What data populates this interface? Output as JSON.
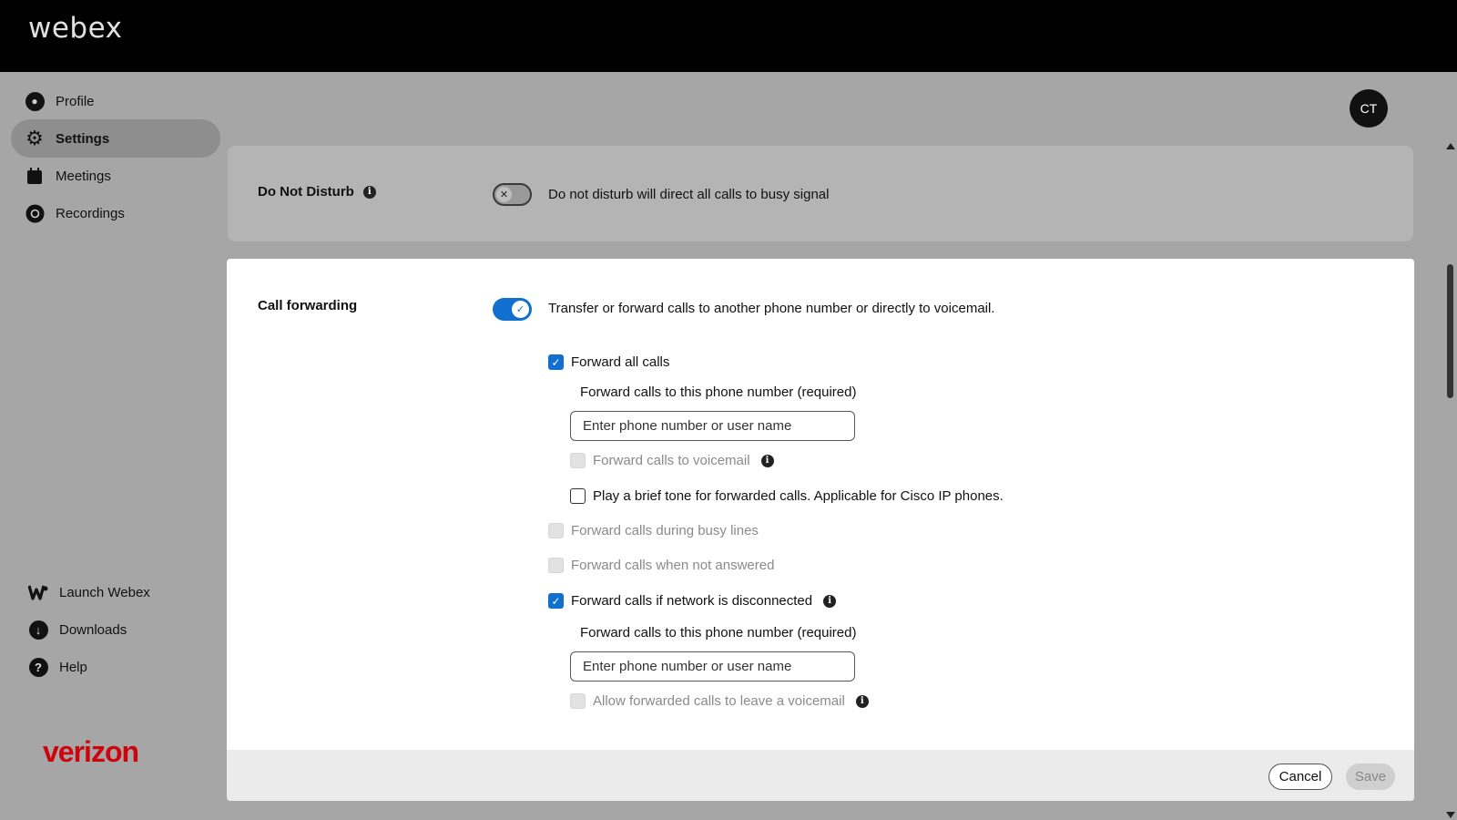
{
  "brand": "webex",
  "sidebar": {
    "items": [
      {
        "label": "Profile",
        "icon": "profile-icon"
      },
      {
        "label": "Settings",
        "icon": "gear-icon",
        "active": true
      },
      {
        "label": "Meetings",
        "icon": "calendar-icon"
      },
      {
        "label": "Recordings",
        "icon": "recording-icon"
      }
    ],
    "bottom_items": [
      {
        "label": "Launch Webex",
        "icon": "webex-logo-icon"
      },
      {
        "label": "Downloads",
        "icon": "download-icon"
      },
      {
        "label": "Help",
        "icon": "help-icon"
      }
    ],
    "carrier_logo": "verizon"
  },
  "avatar": {
    "initials": "CT"
  },
  "do_not_disturb": {
    "title": "Do Not Disturb",
    "enabled": false,
    "description": "Do not disturb will direct all calls to busy signal"
  },
  "call_forwarding": {
    "title": "Call forwarding",
    "enabled": true,
    "description": "Transfer or forward calls to another phone number or directly to voicemail.",
    "forward_all": {
      "label": "Forward all calls",
      "checked": true,
      "number_label": "Forward calls to this phone number (required)",
      "number_placeholder": "Enter phone number or user name",
      "voicemail_label": "Forward calls to voicemail",
      "tone_label": "Play a brief tone for forwarded calls. Applicable for Cisco IP phones."
    },
    "busy_label": "Forward calls during busy lines",
    "not_answered_label": "Forward calls when not answered",
    "network_disconnected": {
      "label": "Forward calls if network is disconnected",
      "checked": true,
      "number_label": "Forward calls to this phone number (required)",
      "number_placeholder": "Enter phone number or user name",
      "voicemail_label": "Allow forwarded calls to leave a voicemail"
    }
  },
  "footer": {
    "cancel": "Cancel",
    "save": "Save"
  },
  "colors": {
    "accent": "#1170cf",
    "topbar": "#000000",
    "verizon_red": "#cd040b"
  }
}
